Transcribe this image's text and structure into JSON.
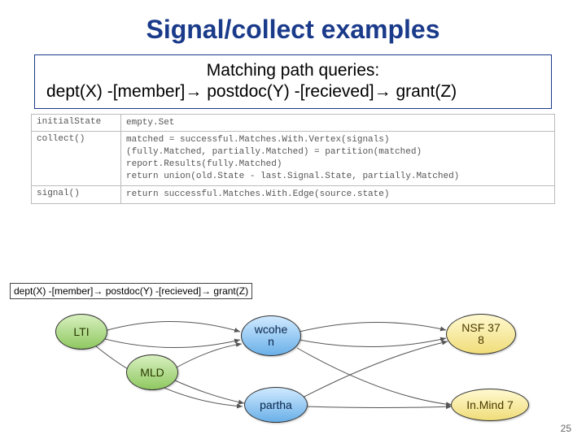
{
  "title": "Signal/collect examples",
  "query": {
    "line1": "Matching path queries:",
    "line2": "dept(X) -[member]→ postdoc(Y) -[recieved]→ grant(Z)"
  },
  "table": {
    "rows": [
      {
        "k": "initialState",
        "v": "empty.Set"
      },
      {
        "k": "collect()",
        "v": "matched = successful.Matches.With.Vertex(signals)\n(fully.Matched, partially.Matched) = partition(matched)\nreport.Results(fully.Matched)\nreturn union(old.State - last.Signal.State, partially.Matched)"
      },
      {
        "k": "signal()",
        "v": "return successful.Matches.With.Edge(source.state)"
      }
    ]
  },
  "miniQuery": "dept(X) -[member]→ postdoc(Y) -[recieved]→ grant(Z)",
  "nodes": {
    "lti": {
      "label": "LTI"
    },
    "mld": {
      "label": "MLD"
    },
    "wcohen": {
      "label": "wcohe\nn"
    },
    "partha": {
      "label": "partha"
    },
    "nsf378": {
      "label": "NSF 37\n8"
    },
    "inmind7": {
      "label": "In.Mind 7"
    }
  },
  "slideNumber": "25"
}
